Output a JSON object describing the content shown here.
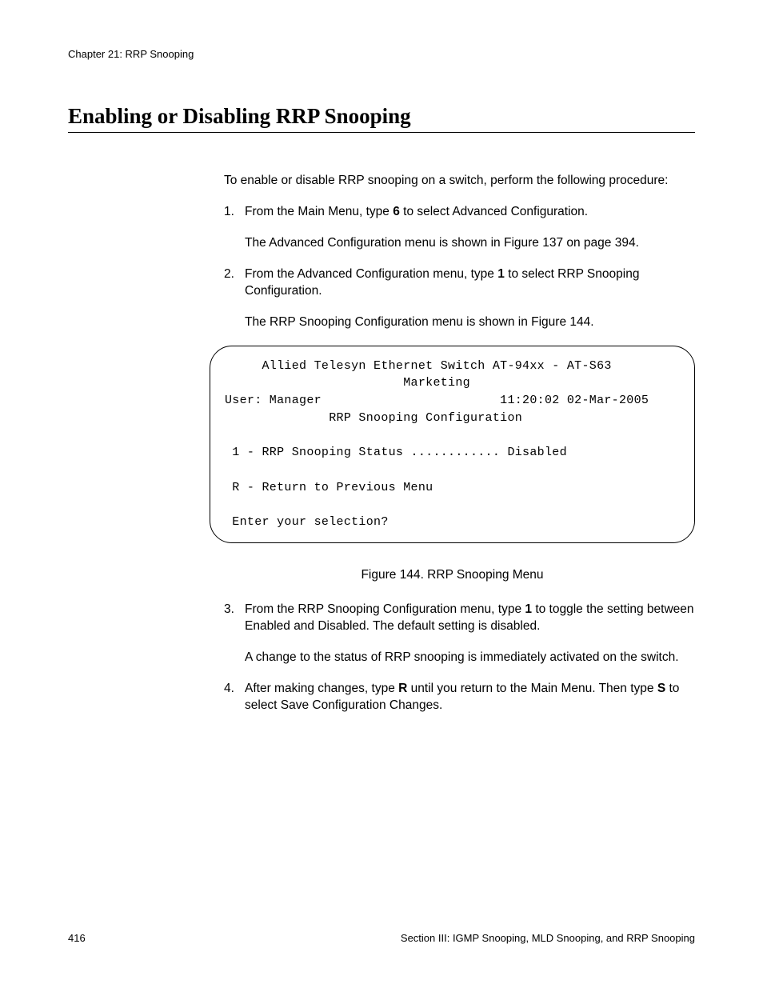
{
  "chapter_header": "Chapter 21: RRP Snooping",
  "section_title": "Enabling or Disabling RRP Snooping",
  "intro": "To enable or disable RRP snooping on a switch, perform the following procedure:",
  "steps": [
    {
      "num": "1.",
      "line1a": "From the Main Menu, type ",
      "line1_bold": "6",
      "line1b": " to select Advanced Configuration.",
      "line2": "The Advanced Configuration menu is shown in Figure 137 on page 394."
    },
    {
      "num": "2.",
      "line1a": "From the Advanced Configuration menu, type ",
      "line1_bold": "1",
      "line1b": " to select RRP Snooping Configuration.",
      "line2": "The RRP Snooping Configuration menu is shown in Figure 144."
    },
    {
      "num": "3.",
      "line1a": "From the RRP Snooping Configuration menu, type ",
      "line1_bold": "1",
      "line1b": " to toggle the setting between Enabled and Disabled. The default setting is disabled.",
      "line2": "A change to the status of RRP snooping is immediately activated on the switch."
    },
    {
      "num": "4.",
      "line1a": "After making changes, type ",
      "line1_bold": "R",
      "line1b": " until you return to the Main Menu. Then type ",
      "line1_bold2": "S",
      "line1c": " to select Save Configuration Changes."
    }
  ],
  "terminal": {
    "line1": "     Allied Telesyn Ethernet Switch AT-94xx - AT-S63",
    "line2": "                        Marketing",
    "line3": "User: Manager                        11:20:02 02-Mar-2005",
    "line4": "              RRP Snooping Configuration",
    "line5": "",
    "line6": " 1 - RRP Snooping Status ............ Disabled",
    "line7": "",
    "line8": " R - Return to Previous Menu",
    "line9": "",
    "line10": " Enter your selection?"
  },
  "figure_caption": "Figure 144. RRP Snooping Menu",
  "footer": {
    "page": "416",
    "section": "Section III: IGMP Snooping, MLD Snooping, and RRP Snooping"
  }
}
